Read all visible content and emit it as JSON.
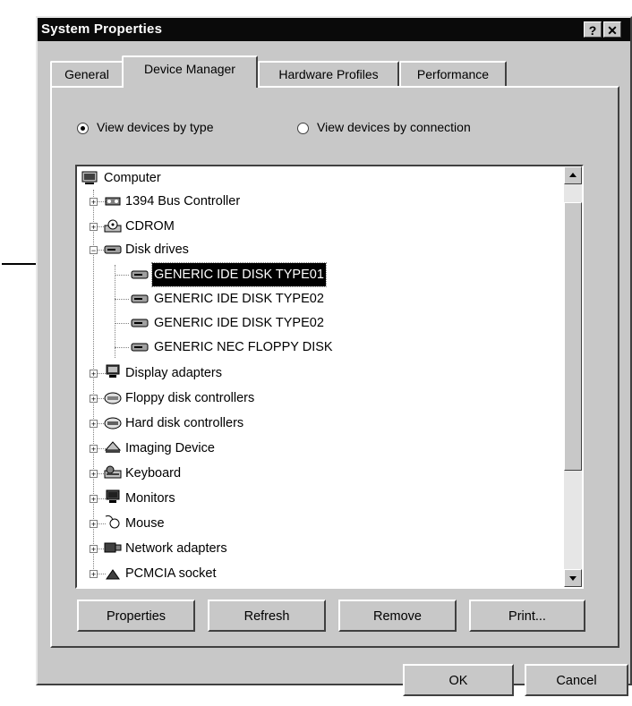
{
  "window": {
    "title": "System Properties",
    "help_label": "?",
    "close_label": "✕"
  },
  "tabs": [
    {
      "label": "General",
      "active": false
    },
    {
      "label": "Device Manager",
      "active": true
    },
    {
      "label": "Hardware Profiles",
      "active": false
    },
    {
      "label": "Performance",
      "active": false
    }
  ],
  "view_options": {
    "by_type": {
      "label": "View devices by type",
      "selected": true
    },
    "by_connection": {
      "label": "View devices by connection",
      "selected": false
    }
  },
  "tree": {
    "root": {
      "label": "Computer",
      "icon": "computer-icon"
    },
    "items": [
      {
        "label": "1394 Bus Controller",
        "icon": "bus-controller-icon",
        "expander": "+"
      },
      {
        "label": "CDROM",
        "icon": "cdrom-icon",
        "expander": "+"
      },
      {
        "label": "Disk drives",
        "icon": "disk-drive-icon",
        "expander": "−"
      },
      {
        "label": "GENERIC IDE  DISK TYPE01",
        "icon": "disk-drive-icon",
        "child": true,
        "selected": true
      },
      {
        "label": "GENERIC IDE  DISK TYPE02",
        "icon": "disk-drive-icon",
        "child": true
      },
      {
        "label": "GENERIC IDE  DISK TYPE02",
        "icon": "disk-drive-icon",
        "child": true
      },
      {
        "label": "GENERIC NEC  FLOPPY DISK",
        "icon": "disk-drive-icon",
        "child": true
      },
      {
        "label": "Display adapters",
        "icon": "display-adapter-icon",
        "expander": "+"
      },
      {
        "label": "Floppy disk controllers",
        "icon": "floppy-controller-icon",
        "expander": "+"
      },
      {
        "label": "Hard disk controllers",
        "icon": "hard-disk-controller-icon",
        "expander": "+"
      },
      {
        "label": "Imaging Device",
        "icon": "imaging-device-icon",
        "expander": "+"
      },
      {
        "label": "Keyboard",
        "icon": "keyboard-icon",
        "expander": "+"
      },
      {
        "label": "Monitors",
        "icon": "monitor-icon",
        "expander": "+"
      },
      {
        "label": "Mouse",
        "icon": "mouse-icon",
        "expander": "+"
      },
      {
        "label": "Network adapters",
        "icon": "network-adapter-icon",
        "expander": "+"
      },
      {
        "label": "PCMCIA socket",
        "icon": "pcmcia-icon",
        "expander": "+"
      }
    ]
  },
  "actions": {
    "properties": "Properties",
    "refresh": "Refresh",
    "remove": "Remove",
    "print": "Print..."
  },
  "dialog_buttons": {
    "ok": "OK",
    "cancel": "Cancel"
  },
  "colors": {
    "face": "#c8c8c8",
    "selection": "#000000",
    "titlebar": "#0a0a0a"
  }
}
